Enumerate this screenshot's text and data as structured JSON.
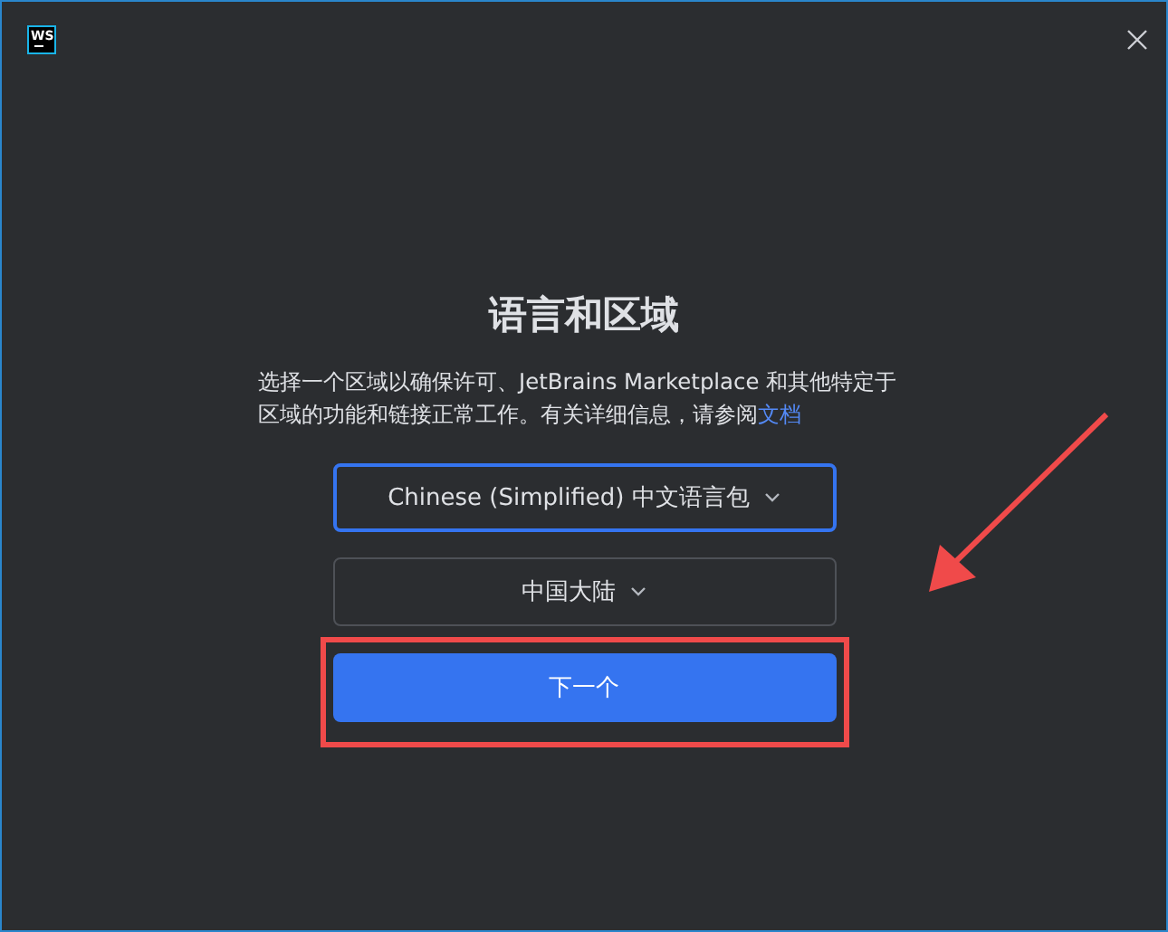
{
  "window": {
    "logo": "WS"
  },
  "title": "语言和区域",
  "description": {
    "text": "选择一个区域以确保许可、JetBrains Marketplace 和其他特定于区域的功能和链接正常工作。有关详细信息，请参阅",
    "link": "文档"
  },
  "dropdowns": [
    {
      "value": "Chinese (Simplified) 中文语言包",
      "focused": true
    },
    {
      "value": "中国大陆",
      "focused": false
    }
  ],
  "next_button": {
    "label": "下一个",
    "highlighted": true
  }
}
